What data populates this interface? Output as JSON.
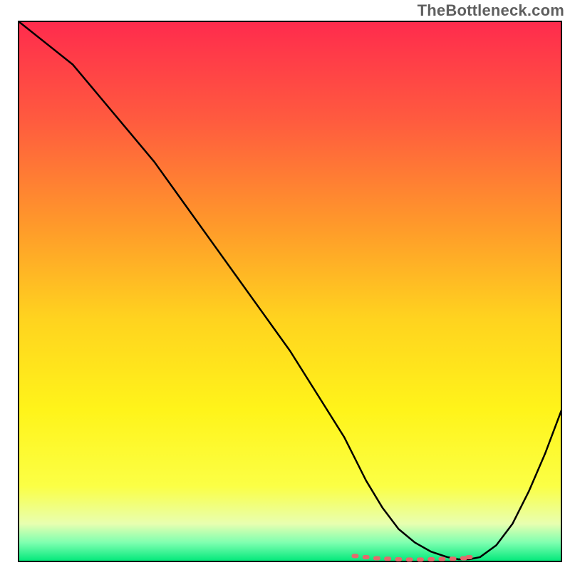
{
  "watermark": "TheBottleneck.com",
  "chart_data": {
    "type": "line",
    "title": "",
    "xlabel": "",
    "ylabel": "",
    "xlim": [
      0,
      100
    ],
    "ylim": [
      0,
      100
    ],
    "grid": false,
    "legend": false,
    "background_gradient": {
      "stops": [
        {
          "offset": 0.0,
          "color": "#ff2b4d"
        },
        {
          "offset": 0.18,
          "color": "#ff5a3f"
        },
        {
          "offset": 0.38,
          "color": "#ff9a2a"
        },
        {
          "offset": 0.55,
          "color": "#ffd31f"
        },
        {
          "offset": 0.72,
          "color": "#fff41a"
        },
        {
          "offset": 0.86,
          "color": "#fbff45"
        },
        {
          "offset": 0.93,
          "color": "#e8ffb0"
        },
        {
          "offset": 0.965,
          "color": "#7fffb0"
        },
        {
          "offset": 1.0,
          "color": "#00e87a"
        }
      ]
    },
    "series": [
      {
        "name": "curve",
        "stroke": "#000000",
        "stroke_width": 2.5,
        "x": [
          0,
          5,
          10,
          15,
          20,
          25,
          30,
          35,
          40,
          45,
          50,
          55,
          60,
          62,
          64,
          67,
          70,
          73,
          76,
          79,
          81,
          83,
          85,
          88,
          91,
          94,
          97,
          100
        ],
        "y": [
          100,
          96,
          92,
          86,
          80,
          74,
          67,
          60,
          53,
          46,
          39,
          31,
          23,
          19,
          15,
          10,
          6,
          3.5,
          1.8,
          0.8,
          0.4,
          0.4,
          0.8,
          3,
          7,
          13,
          20,
          28
        ]
      },
      {
        "name": "markers-flat-zone",
        "stroke": "#e46a6d",
        "stroke_width": 6,
        "type_hint": "dotted",
        "x": [
          62,
          64,
          66,
          68,
          70,
          72,
          74,
          76,
          78,
          80,
          82,
          83
        ],
        "y": [
          1.0,
          0.8,
          0.6,
          0.5,
          0.4,
          0.35,
          0.35,
          0.4,
          0.45,
          0.5,
          0.6,
          0.8
        ]
      }
    ]
  }
}
